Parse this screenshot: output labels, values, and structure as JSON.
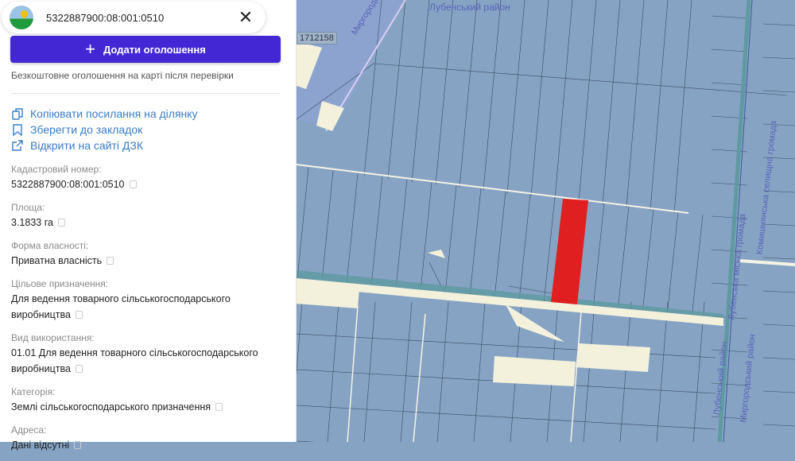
{
  "search": {
    "value": "5322887900:08:001:0510",
    "logo": "app-logo",
    "close_icon": "close-icon"
  },
  "add_button": {
    "label": "Додати оголошення",
    "icon": "plus-icon"
  },
  "hint": "Безкоштовне оголошення на карті після перевірки",
  "links": [
    {
      "label": "Копіювати посилання на ділянку",
      "icon": "copy-icon"
    },
    {
      "label": "Зберегти до закладок",
      "icon": "bookmark-icon"
    },
    {
      "label": "Відкрити на сайті ДЗК",
      "icon": "external-link-icon"
    }
  ],
  "fields": [
    {
      "label": "Кадастровий номер:",
      "value": "5322887900:08:001:0510"
    },
    {
      "label": "Площа:",
      "value": "3.1833 га"
    },
    {
      "label": "Форма власності:",
      "value": "Приватна власність"
    },
    {
      "label": "Цільове призначення:",
      "value": "Для ведення товарного сільськогосподарського виробництва"
    },
    {
      "label": "Вид використання:",
      "value": "01.01 Для ведення товарного сільськогосподарського виробництва"
    },
    {
      "label": "Категорія:",
      "value": "Землі сільськогосподарського призначення"
    },
    {
      "label": "Адреса:",
      "value": "Дані відсутні"
    }
  ],
  "map": {
    "labels": {
      "top": "Лубенський район",
      "diag": "Миргородський район",
      "parcel_id": "1712158",
      "v1": "Лубенська міська громада",
      "v2": "Комишнянська селищна громада",
      "v3": "Лубенський район",
      "v4": "Миргородський район"
    },
    "colors": {
      "parcel": "#86a3c4",
      "selected": "#e02020",
      "road": "#f3f1dc"
    }
  }
}
